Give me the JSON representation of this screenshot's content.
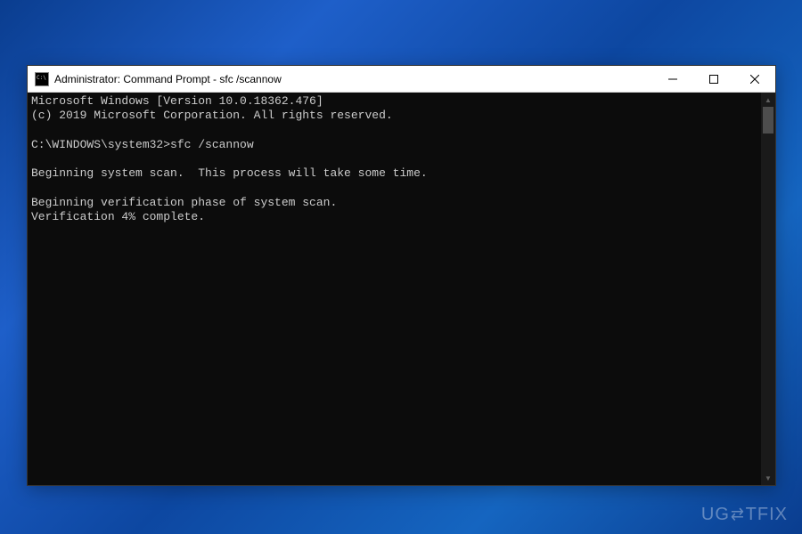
{
  "window": {
    "title": "Administrator: Command Prompt - sfc  /scannow"
  },
  "terminal": {
    "line1": "Microsoft Windows [Version 10.0.18362.476]",
    "line2": "(c) 2019 Microsoft Corporation. All rights reserved.",
    "blank1": "",
    "prompt_line": "C:\\WINDOWS\\system32>sfc /scannow",
    "blank2": "",
    "line3": "Beginning system scan.  This process will take some time.",
    "blank3": "",
    "line4": "Beginning verification phase of system scan.",
    "line5": "Verification 4% complete."
  },
  "watermark": {
    "text": "UG⇄TFIX"
  }
}
